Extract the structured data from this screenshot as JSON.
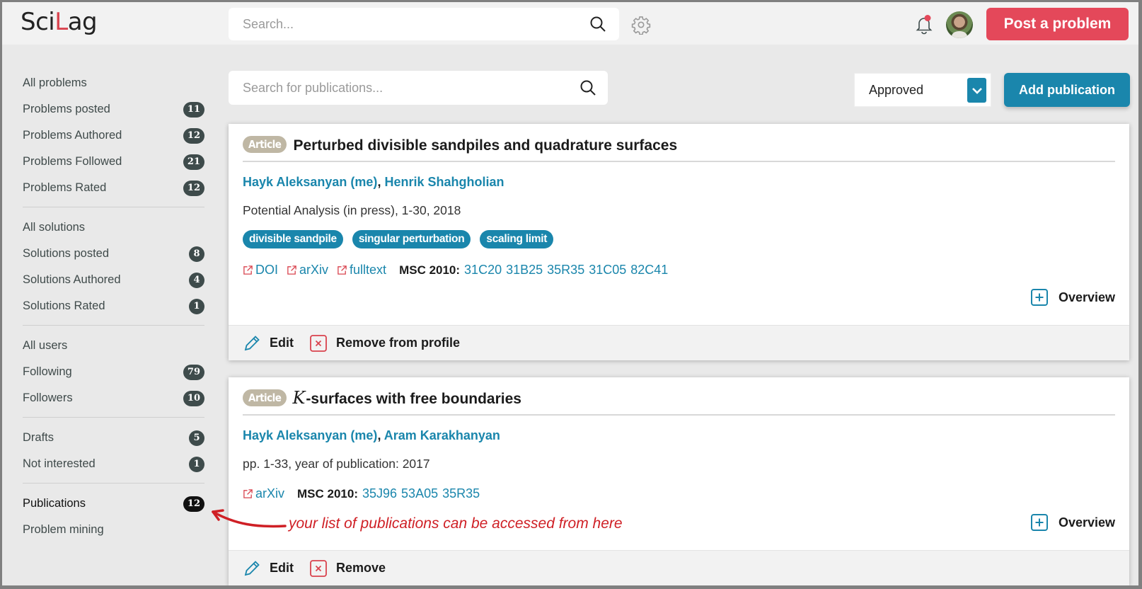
{
  "header": {
    "logo_prefix": "Sci",
    "logo_accent": "L",
    "logo_suffix": "ag",
    "search_placeholder": "Search...",
    "post_button": "Post a problem",
    "notification_dot": true,
    "brand_color": "#e4485a"
  },
  "sidebar": {
    "groups": [
      [
        {
          "label": "All problems",
          "count": null
        },
        {
          "label": "Problems posted",
          "count": "11"
        },
        {
          "label": "Problems Authored",
          "count": "12"
        },
        {
          "label": "Problems Followed",
          "count": "21"
        },
        {
          "label": "Problems Rated",
          "count": "12"
        }
      ],
      [
        {
          "label": "All solutions",
          "count": null
        },
        {
          "label": "Solutions posted",
          "count": "8"
        },
        {
          "label": "Solutions Authored",
          "count": "4"
        },
        {
          "label": "Solutions Rated",
          "count": "1"
        }
      ],
      [
        {
          "label": "All users",
          "count": null
        },
        {
          "label": "Following",
          "count": "79"
        },
        {
          "label": "Followers",
          "count": "10"
        }
      ],
      [
        {
          "label": "Drafts",
          "count": "5"
        },
        {
          "label": "Not interested",
          "count": "1"
        }
      ],
      [
        {
          "label": "Publications",
          "count": "12",
          "active": true
        },
        {
          "label": "Problem mining",
          "count": null
        }
      ]
    ]
  },
  "toolbar": {
    "search_placeholder": "Search for publications...",
    "status_selected": "Approved",
    "add_button": "Add publication",
    "accent_color": "#1a86ac"
  },
  "publications": [
    {
      "type": "Article",
      "title_math": "",
      "title": "Perturbed divisible sandpiles and quadrature surfaces",
      "authors": [
        "Hayk Aleksanyan (me)",
        "Henrik Shahgholian"
      ],
      "source": "Potential Analysis (in press), 1-30, 2018",
      "tags": [
        "divisible sandpile",
        "singular perturbation",
        "scaling limit"
      ],
      "links": [
        "DOI",
        "arXiv",
        "fulltext"
      ],
      "msc_label": "MSC 2010:",
      "msc_codes": [
        "31C20",
        "31B25",
        "35R35",
        "31C05",
        "82C41"
      ],
      "overview_label": "Overview",
      "edit_label": "Edit",
      "remove_label": "Remove from profile"
    },
    {
      "type": "Article",
      "title_math": "K",
      "title": "-surfaces with free boundaries",
      "authors": [
        "Hayk Aleksanyan (me)",
        "Aram Karakhanyan"
      ],
      "source": "pp. 1-33, year of publication: 2017",
      "tags": [],
      "links": [
        "arXiv"
      ],
      "msc_label": "MSC 2010:",
      "msc_codes": [
        "35J96",
        "53A05",
        "35R35"
      ],
      "overview_label": "Overview",
      "edit_label": "Edit",
      "remove_label": "Remove"
    }
  ],
  "annotation": {
    "text": "your list of publications can be accessed from here",
    "color": "#cf1f25"
  }
}
